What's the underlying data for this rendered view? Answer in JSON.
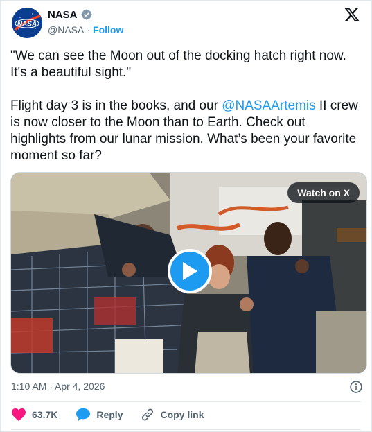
{
  "author": {
    "name": "NASA",
    "handle": "@NASA",
    "separator": "·",
    "follow_label": "Follow",
    "avatar_text": "NASA"
  },
  "tweet": {
    "quote": "\"We can see the Moon out of the docking hatch right now. It's a beautiful sight.\"",
    "body_before": "Flight day 3 is in the books, and our ",
    "mention": "@NASAArtemis",
    "body_after": " II crew is now closer to the Moon than to Earth. Check out highlights from our lunar mission. What’s been your favorite moment so far?"
  },
  "media": {
    "watch_label": "Watch on X",
    "type": "video"
  },
  "footer": {
    "timestamp": "1:10 AM · Apr 4, 2026",
    "likes": "63.7K",
    "reply_label": "Reply",
    "copy_label": "Copy link"
  },
  "colors": {
    "accent": "#1d9bf0",
    "like": "#f91880",
    "text": "#0f1419",
    "muted": "#536471"
  }
}
